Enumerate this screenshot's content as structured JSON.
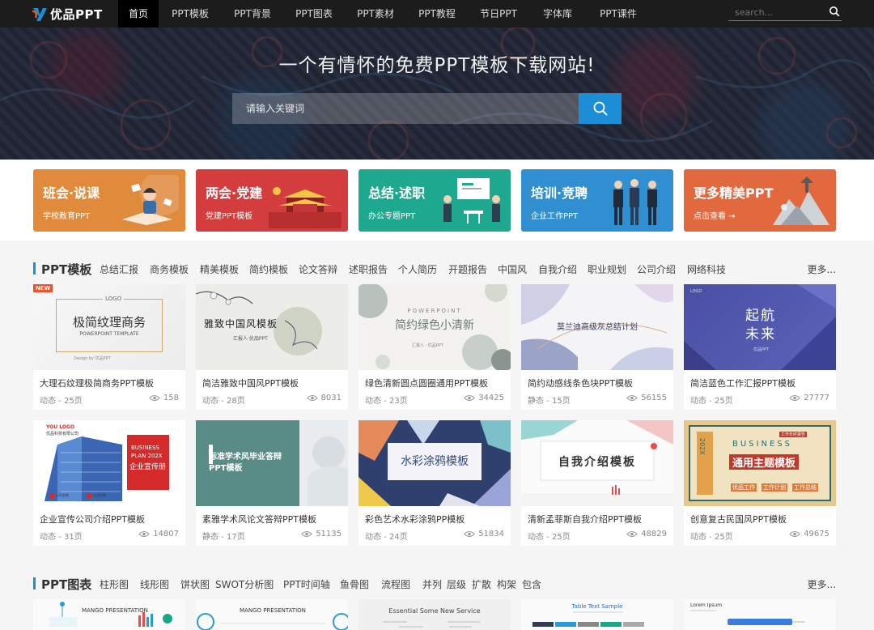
{
  "brand": {
    "name": "优品PPT",
    "accent": "#1b8ed6"
  },
  "nav": {
    "items": [
      {
        "label": "首页",
        "active": true
      },
      {
        "label": "PPT模板"
      },
      {
        "label": "PPT背景"
      },
      {
        "label": "PPT图表"
      },
      {
        "label": "PPT素材"
      },
      {
        "label": "PPT教程"
      },
      {
        "label": "节日PPT"
      },
      {
        "label": "字体库"
      },
      {
        "label": "PPT课件"
      }
    ],
    "search_placeholder": "search..."
  },
  "hero": {
    "title": "一个有情怀的免费PPT模板下载网站!",
    "search_placeholder": "请输入关键词"
  },
  "categories": [
    {
      "title": "班会·说课",
      "sub": "学校教育PPT",
      "color": "#e08a3c"
    },
    {
      "title": "两会·党建",
      "sub": "党建PPT模板",
      "color": "#d33d3d"
    },
    {
      "title": "总结·述职",
      "sub": "办公专题PPT",
      "color": "#1fa890"
    },
    {
      "title": "培训·竞聘",
      "sub": "企业工作PPT",
      "color": "#2f8fd0"
    },
    {
      "title": "更多精美PPT",
      "sub": "点击查看 →",
      "color": "#e2693e"
    }
  ],
  "sections": {
    "templates": {
      "title": "PPT模板",
      "tags": [
        "总结汇报",
        "商务模板",
        "精美模板",
        "简约模板",
        "论文答辩",
        "述职报告",
        "个人简历",
        "开题报告",
        "中国风",
        "自我介绍",
        "职业规划",
        "公司介绍",
        "网络科技"
      ],
      "more": "更多...",
      "cards": [
        {
          "name": "大理石纹理极简商务PPT模板",
          "meta": "动态 - 25页",
          "views": "158",
          "badge": "NEW",
          "thumb": {
            "main": "极简纹理商务",
            "top": "LOGO",
            "sub": "POWERPOINT TEMPLATE",
            "foot": "Design by 优品PPT"
          }
        },
        {
          "name": "简洁雅致中国风PPT模板",
          "meta": "动态 - 28页",
          "views": "8031",
          "thumb": {
            "main": "雅致中国风模板",
            "sub": "汇报人·优品PPT"
          }
        },
        {
          "name": "绿色清新圆点圆圈通用PPT模板",
          "meta": "动态 - 23页",
          "views": "34425",
          "thumb": {
            "top": "POWERPOINT",
            "main": "简约绿色小清新",
            "sub": "汇报人 · 优品PPT"
          }
        },
        {
          "name": "简约动感线条色块PPT模板",
          "meta": "静态 - 15页",
          "views": "56155",
          "thumb": {
            "main": "莫兰迪高级灰总结计划"
          }
        },
        {
          "name": "简洁蓝色工作汇报PPT模板",
          "meta": "动态 - 25页",
          "views": "27777",
          "thumb": {
            "top": "LOGO",
            "main": "起航",
            "main2": "未来",
            "sub": "优品PPT"
          }
        },
        {
          "name": "企业宣传公司介绍PPT模板",
          "meta": "动态 - 31页",
          "views": "14807",
          "thumb": {
            "top": "YOU LOGO",
            "top2": "优品科技有限公司",
            "main": "BUSINESS",
            "main2": "PLAN 202X",
            "main3": "企业宣传册",
            "foot": "公司名称",
            "foot2": "公司名称"
          }
        },
        {
          "name": "素雅学术风论文答辩PPT模板",
          "meta": "静态 - 17页",
          "views": "51135",
          "thumb": {
            "main": "标准学术风毕业答辩",
            "main2": "PPT模板"
          }
        },
        {
          "name": "彩色艺术水彩涂鸦PP模板",
          "meta": "动态 - 24页",
          "views": "51834",
          "thumb": {
            "main": "水彩涂鸦模板"
          }
        },
        {
          "name": "清新孟菲斯自我介绍PPT模板",
          "meta": "动态 - 25页",
          "views": "48829",
          "thumb": {
            "main": "自我介绍模板"
          }
        },
        {
          "name": "创意复古民国风PPT模板",
          "meta": "动态 - 25页",
          "views": "49675",
          "thumb": {
            "main": "BUSINESS",
            "main2": "通用主题模板",
            "side": "202X",
            "foot": "优品工作",
            "foot2": "工作计划",
            "foot3": "工作总结",
            "top": "工作年终报告"
          }
        }
      ]
    },
    "charts": {
      "title": "PPT图表",
      "tags": [
        "柱形图",
        "线形图",
        "饼状图",
        "SWOT分析图",
        "PPT时间轴",
        "鱼骨图",
        "流程图",
        "并列",
        "层级",
        "扩散",
        "构架",
        "包含"
      ],
      "more": "更多...",
      "cards": [
        {
          "thumb": {
            "main": "MANGO PRESENTATION"
          }
        },
        {
          "thumb": {
            "main": "MANGO PRESENTATION"
          }
        },
        {
          "thumb": {
            "main": "Essential Some New Service"
          }
        },
        {
          "thumb": {
            "main": "Table Text Sample"
          }
        },
        {
          "thumb": {
            "main": "Lorem Ipsum"
          }
        }
      ]
    }
  }
}
